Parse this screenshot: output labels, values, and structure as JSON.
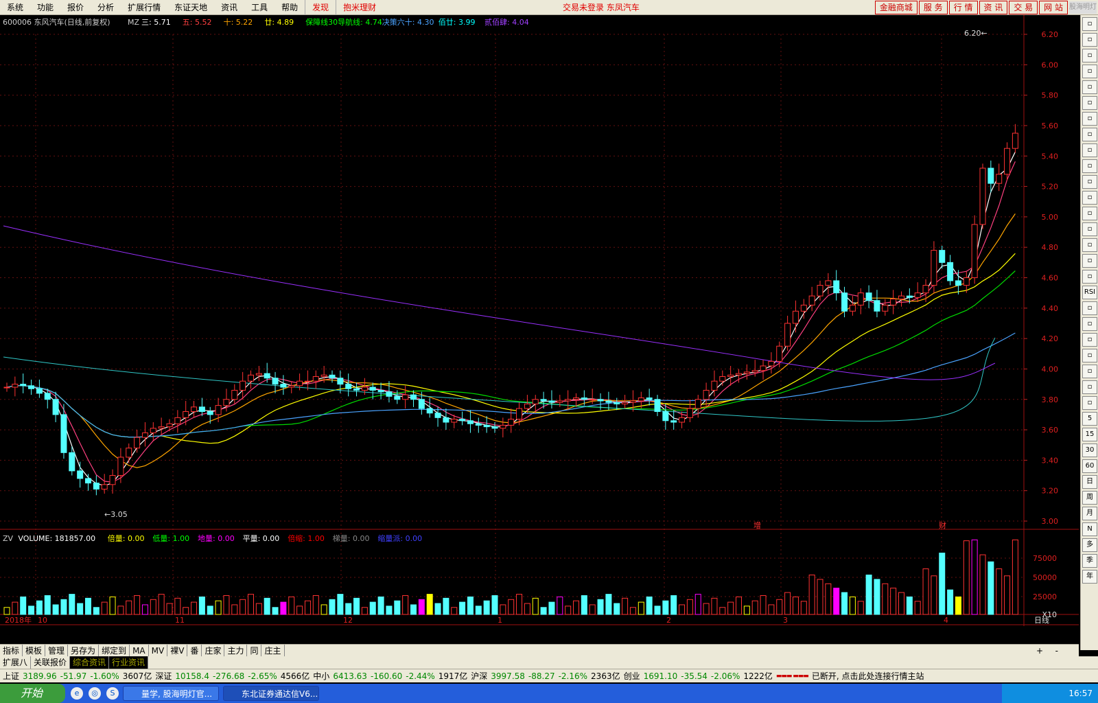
{
  "menu": {
    "items": [
      "系统",
      "功能",
      "报价",
      "分析",
      "扩展行情",
      "东证天地",
      "资讯",
      "工具",
      "帮助"
    ],
    "faxian": "发现",
    "baomi": "抱米理财",
    "status": "交易未登录 东凤汽车",
    "right": [
      "金融商城",
      "服 务",
      "行 情",
      "资 讯",
      "交 易",
      "网 站"
    ],
    "logo": "股海明灯"
  },
  "info_line": {
    "code": "600006 东风汽车(日线,前复权)",
    "mz": "MZ",
    "items": [
      {
        "t": "三: 5.71",
        "c": "#ffffff"
      },
      {
        "t": "五: 5.52",
        "c": "#ff4040"
      },
      {
        "t": "十: 5.22",
        "c": "#ffa500"
      },
      {
        "t": "廿: 4.89",
        "c": "#ffff00"
      },
      {
        "t": "保障线30导航线: 4.74",
        "c": "#00ff00"
      },
      {
        "t": "决策六十: 4.30",
        "c": "#4aa3ff"
      },
      {
        "t": "佰廿: 3.99",
        "c": "#00ffff"
      },
      {
        "t": "贰佰肆: 4.04",
        "c": "#a040ff"
      }
    ]
  },
  "vol_line": {
    "items": [
      {
        "t": "ZV",
        "c": "#ccc"
      },
      {
        "t": "VOLUME: 181857.00",
        "c": "#fff"
      },
      {
        "t": "倍量: 0.00",
        "c": "#ffff00"
      },
      {
        "t": "低量: 1.00",
        "c": "#00ff00"
      },
      {
        "t": "地量: 0.00",
        "c": "#ff00ff"
      },
      {
        "t": "平量: 0.00",
        "c": "#fff"
      },
      {
        "t": "倍缩: 1.00",
        "c": "#ff0000"
      },
      {
        "t": "梯量: 0.00",
        "c": "#888"
      },
      {
        "t": "缩量派: 0.00",
        "c": "#4040ff"
      }
    ]
  },
  "price_axis": [
    "6.20",
    "6.00",
    "5.80",
    "5.60",
    "5.40",
    "5.20",
    "5.00",
    "4.80",
    "4.60",
    "4.40",
    "4.20",
    "4.00",
    "3.80",
    "3.60",
    "3.40",
    "3.20",
    "3.00"
  ],
  "vol_axis": [
    "75000",
    "50000",
    "25000",
    "X10"
  ],
  "date_axis": [
    "2018年",
    "10",
    "11",
    "12",
    "1",
    "2",
    "3",
    "4"
  ],
  "period": "日线",
  "annotations": {
    "low": "3.05",
    "high": "6.20",
    "zeng": "增",
    "cai": "财"
  },
  "chart_data": {
    "type": "candlestick",
    "price_ylim": [
      3.0,
      6.2
    ],
    "volume_unit": "X10",
    "volume_ticks": [
      25000,
      50000,
      75000
    ]
  },
  "right_tools": [
    "",
    "",
    "",
    "",
    "",
    "",
    "",
    "",
    "",
    "",
    "",
    "",
    "",
    "",
    "",
    "",
    "",
    "RSI",
    "",
    "",
    "",
    "",
    "",
    "",
    "",
    "5",
    "15",
    "30",
    "60",
    "日",
    "周",
    "月",
    "N",
    "多",
    "季",
    "年"
  ],
  "tabs1": [
    "指标",
    "模板",
    "管理",
    "另存为",
    "绑定到",
    "MA",
    "MV",
    "裸V",
    "番",
    "庄家",
    "主力",
    "同",
    "庄主"
  ],
  "tabs2": [
    "扩展八",
    "关联报价",
    "综合资讯",
    "行业资讯"
  ],
  "status": {
    "sh": "上证",
    "sh_v": "3189.96",
    "sh_c": "-51.97",
    "sh_p": "-1.60%",
    "sh_a": "3607亿",
    "sz": "深证",
    "sz_v": "10158.4",
    "sz_c": "-276.68",
    "sz_p": "-2.65%",
    "sz_a": "4566亿",
    "zx": "中小",
    "zx_v": "6413.63",
    "zx_c": "-160.60",
    "zx_p": "-2.44%",
    "zx_a": "1917亿",
    "hs": "沪深",
    "hs_v": "3997.58",
    "hs_c": "-88.27",
    "hs_p": "-2.16%",
    "hs_a": "2363亿",
    "cy": "创业",
    "cy_v": "1691.10",
    "cy_c": "-35.54",
    "cy_p": "-2.06%",
    "cy_a": "1222亿",
    "disc": "已断开, 点击此处连接行情主站"
  },
  "taskbar": {
    "start": "开始",
    "t1": "量学, 股海明灯官...",
    "t2": "东北证券通达信V6...",
    "clock": "16:57"
  }
}
